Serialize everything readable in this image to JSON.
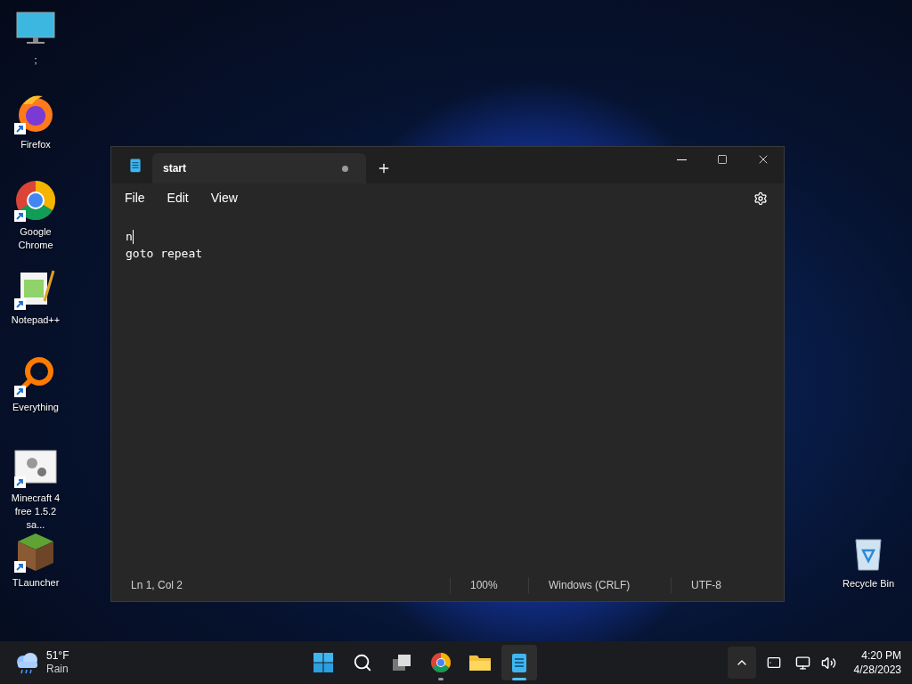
{
  "desktop_icons": [
    {
      "label": ";",
      "kind": "monitor",
      "shortcut": false
    },
    {
      "label": "Firefox",
      "kind": "firefox",
      "shortcut": true
    },
    {
      "label": "Google Chrome",
      "kind": "chrome",
      "shortcut": true
    },
    {
      "label": "Notepad++",
      "kind": "notepadpp",
      "shortcut": true
    },
    {
      "label": "Everything",
      "kind": "everything",
      "shortcut": true
    },
    {
      "label": "Minecraft 4 free 1.5.2 sa...",
      "kind": "gears",
      "shortcut": true
    },
    {
      "label": "TLauncher",
      "kind": "block",
      "shortcut": true
    },
    {
      "label": "Recycle Bin",
      "kind": "bin",
      "shortcut": false
    }
  ],
  "window": {
    "tabs": [
      {
        "label": "start",
        "selected": true,
        "modified": true
      }
    ],
    "menu": [
      "File",
      "Edit",
      "View"
    ],
    "lines": [
      {
        "text": "n",
        "caret": true
      },
      {
        "text": "goto repeat",
        "caret": false
      }
    ],
    "status_bar": [
      "Ln 1, Col 2",
      "100%",
      "Windows (CRLF)",
      "UTF-8"
    ]
  },
  "taskbar": {
    "weather": {
      "temperature": "51°F",
      "condition": "Rain"
    },
    "apps": [
      {
        "kind": "start",
        "running": false,
        "focused": false
      },
      {
        "kind": "search",
        "running": false,
        "focused": false
      },
      {
        "kind": "taskview",
        "running": false,
        "focused": false
      },
      {
        "kind": "chrome",
        "running": true,
        "focused": false
      },
      {
        "kind": "folder",
        "running": false,
        "focused": false
      },
      {
        "kind": "notepad",
        "running": true,
        "focused": true
      }
    ],
    "time": "4:20 PM",
    "date": "4/28/2023"
  }
}
